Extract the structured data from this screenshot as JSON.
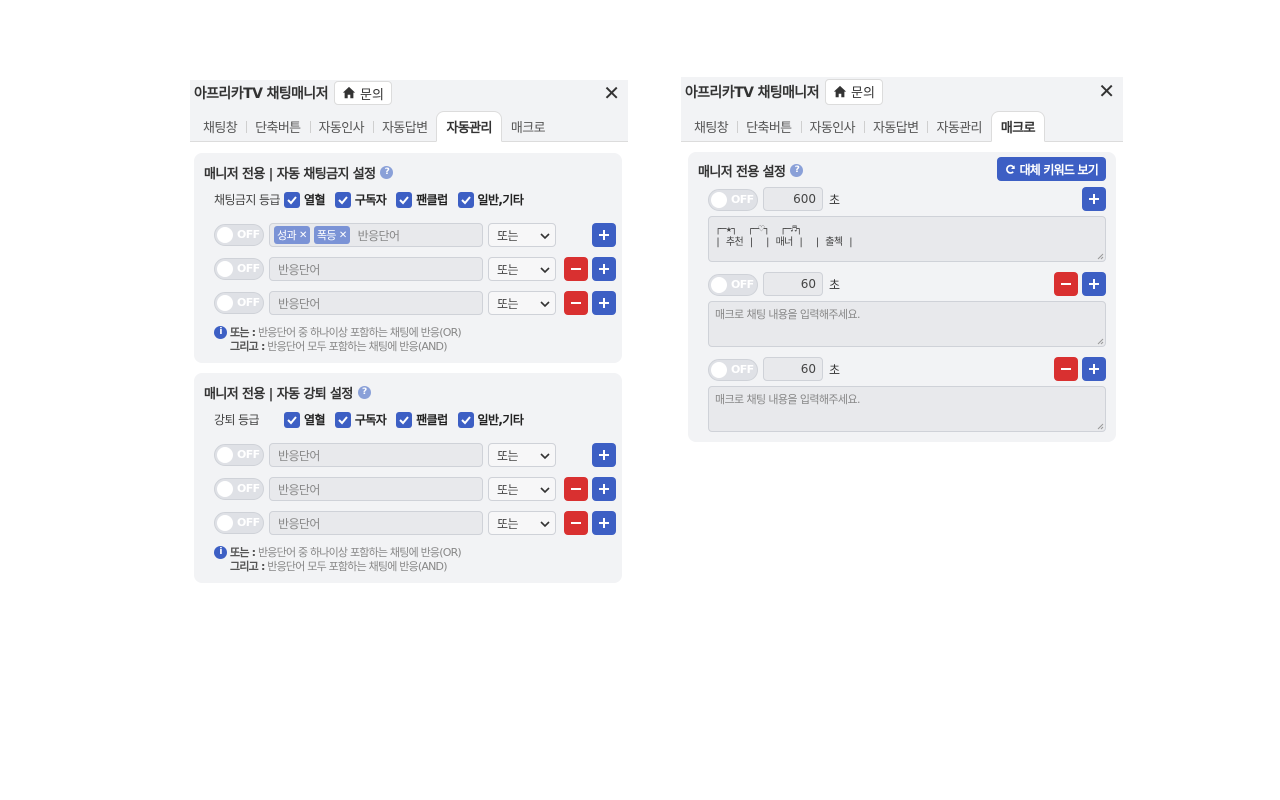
{
  "left": {
    "title": "아프리카TV 채팅매니저",
    "home_label": "문의",
    "close_glyph": "✕",
    "tabs": [
      "채팅창",
      "단축버튼",
      "자동인사",
      "자동답변",
      "자동관리",
      "매크로"
    ],
    "active_tab": "자동관리",
    "ban_card": {
      "title": "매니저 전용 | 자동 채팅금지 설정",
      "grade_label": "채팅금지 등급",
      "grades": [
        "열혈",
        "구독자",
        "팬클럽",
        "일반,기타"
      ],
      "rows": [
        {
          "toggle": "OFF",
          "tags": [
            "성과",
            "폭등"
          ],
          "placeholder": "반응단어",
          "select": "또는"
        },
        {
          "toggle": "OFF",
          "tags": [],
          "placeholder": "반응단어",
          "select": "또는"
        },
        {
          "toggle": "OFF",
          "tags": [],
          "placeholder": "반응단어",
          "select": "또는"
        }
      ],
      "info_or_label": "또는 :",
      "info_or_text": "반응단어 중 하나이상 포함하는 채팅에 반응(OR)",
      "info_and_label": "그리고 :",
      "info_and_text": "반응단어 모두 포함하는 채팅에 반응(AND)"
    },
    "kick_card": {
      "title": "매니저 전용 | 자동 강퇴 설정",
      "grade_label": "강퇴 등급",
      "grades": [
        "열혈",
        "구독자",
        "팬클럽",
        "일반,기타"
      ],
      "rows": [
        {
          "toggle": "OFF",
          "placeholder": "반응단어",
          "select": "또는"
        },
        {
          "toggle": "OFF",
          "placeholder": "반응단어",
          "select": "또는"
        },
        {
          "toggle": "OFF",
          "placeholder": "반응단어",
          "select": "또는"
        }
      ],
      "info_or_label": "또는 :",
      "info_or_text": "반응단어 중 하나이상 포함하는 채팅에 반응(OR)",
      "info_and_label": "그리고 :",
      "info_and_text": "반응단어 모두 포함하는 채팅에 반응(AND)"
    }
  },
  "right": {
    "title": "아프리카TV 채팅매니저",
    "home_label": "문의",
    "close_glyph": "✕",
    "tabs": [
      "채팅창",
      "단축버튼",
      "자동인사",
      "자동답변",
      "자동관리",
      "매크로"
    ],
    "active_tab": "매크로",
    "macro_card": {
      "title": "매니저 전용 설정",
      "alt_button": "대체 키워드 보기",
      "unit": "초",
      "macros": [
        {
          "toggle": "OFF",
          "seconds": "600",
          "text": "┌─★┐  ┌─♡┐  ┌─♬┐\n| 추천 |  | 매너 |  | 출첵 |",
          "placeholder": ""
        },
        {
          "toggle": "OFF",
          "seconds": "60",
          "text": "",
          "placeholder": "매크로 채팅 내용을 입력해주세요."
        },
        {
          "toggle": "OFF",
          "seconds": "60",
          "text": "",
          "placeholder": "매크로 채팅 내용을 입력해주세요."
        }
      ]
    }
  },
  "icons": {
    "home": "home-icon",
    "close": "close-icon",
    "help": "question-icon",
    "info": "info-icon",
    "plus": "plus-icon",
    "minus": "minus-icon",
    "check": "check-icon",
    "refresh": "refresh-icon",
    "chevron": "chevron-down-icon"
  },
  "colors": {
    "accent": "#3d5fc4",
    "danger": "#d93030",
    "tag": "#7b93d6",
    "card_bg": "#f2f3f5"
  }
}
